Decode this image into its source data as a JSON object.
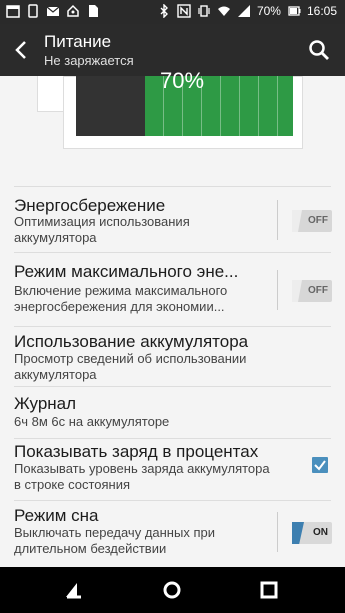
{
  "status_bar": {
    "battery_percent": "70%",
    "time": "16:05",
    "left_icons": [
      "calendar-icon",
      "phone-icon",
      "mail-icon",
      "home-icon",
      "doc-icon"
    ],
    "right_icons": [
      "bluetooth-icon",
      "nfc-icon",
      "vibrate-icon",
      "wifi-icon",
      "signal-icon",
      "battery-icon"
    ]
  },
  "action_bar": {
    "title": "Питание",
    "subtitle": "Не заряжается"
  },
  "battery_graphic": {
    "percent_text": "70%",
    "fill_level": 0.7,
    "fill_color": "#2e9a45"
  },
  "settings": [
    {
      "title": "Энергосбережение",
      "subtitle": "Оптимизация использования аккумулятора",
      "control": "toggle",
      "state": "OFF"
    },
    {
      "title": "Режим максимального эне...",
      "subtitle": "Включение режима максимального энергосбережения для экономии...",
      "control": "toggle",
      "state": "OFF"
    },
    {
      "title": "Использование аккумулятора",
      "subtitle": "Просмотр сведений об использовании аккумулятора",
      "control": "none"
    },
    {
      "title": "Журнал",
      "subtitle": "6ч 8м 6с на аккумуляторе",
      "control": "none"
    },
    {
      "title": "Показывать заряд в процентах",
      "subtitle": "Показывать уровень заряда аккумулятора в строке состояния",
      "control": "checkbox",
      "checked": true
    },
    {
      "title": "Режим сна",
      "subtitle": "Выключать передачу данных при длительном бездействии",
      "control": "toggle",
      "state": "ON"
    }
  ],
  "colors": {
    "accent": "#3d7fb0",
    "action_bar": "#2b2b2b",
    "battery_green": "#2e9a45"
  }
}
